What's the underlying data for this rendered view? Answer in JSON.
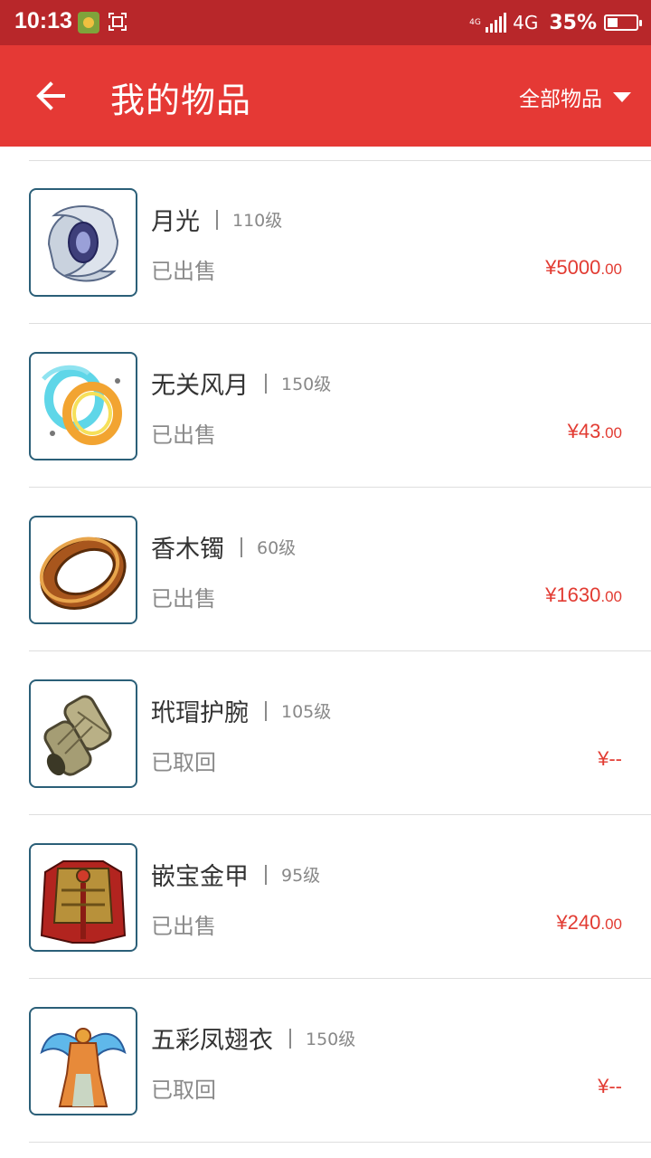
{
  "status_bar": {
    "time": "10:13",
    "network_small": "4G",
    "network": "4G",
    "battery": "35%",
    "battery_level": 0.35
  },
  "header": {
    "title": "我的物品",
    "filter_label": "全部物品"
  },
  "items": [
    {
      "name": "月光",
      "level": "110级",
      "status": "已出售",
      "price_main": "¥5000",
      "price_decimal": ".00",
      "icon": "crescent-blade-icon"
    },
    {
      "name": "无关风月",
      "level": "150级",
      "status": "已出售",
      "price_main": "¥43",
      "price_decimal": ".00",
      "icon": "swirl-ring-icon"
    },
    {
      "name": "香木镯",
      "level": "60级",
      "status": "已出售",
      "price_main": "¥1630",
      "price_decimal": ".00",
      "icon": "wooden-bracelet-icon"
    },
    {
      "name": "玳瑁护腕",
      "level": "105级",
      "status": "已取回",
      "price_main": "¥--",
      "price_decimal": "",
      "icon": "bracer-icon"
    },
    {
      "name": "嵌宝金甲",
      "level": "95级",
      "status": "已出售",
      "price_main": "¥240",
      "price_decimal": ".00",
      "icon": "golden-armor-icon"
    },
    {
      "name": "五彩凤翅衣",
      "level": "150级",
      "status": "已取回",
      "price_main": "¥--",
      "price_decimal": "",
      "icon": "phoenix-robe-icon"
    }
  ],
  "colors": {
    "status_bar": "#b8272a",
    "app_bar": "#e53935",
    "price": "#e23b32"
  }
}
